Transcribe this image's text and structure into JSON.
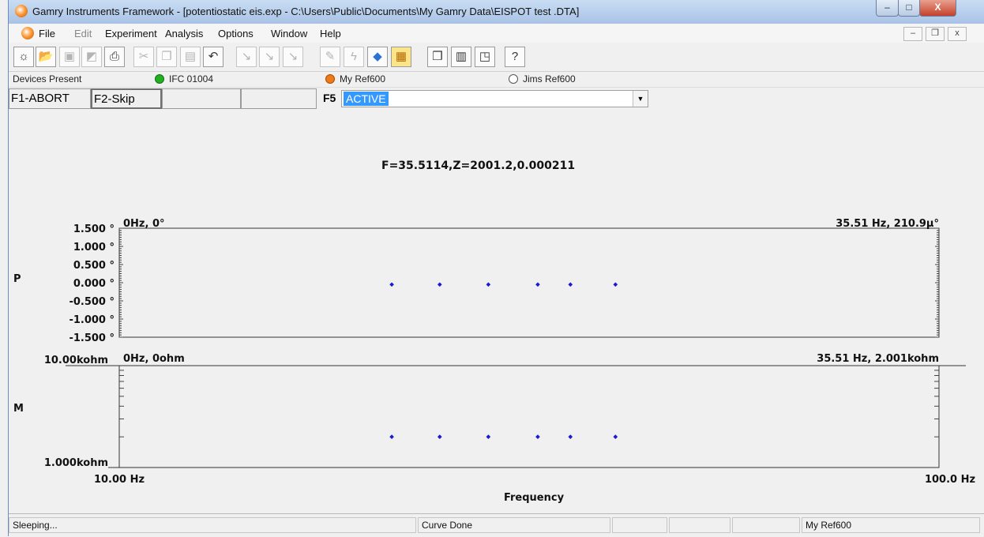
{
  "window": {
    "title": "Gamry Instruments Framework - [potentiostatic eis.exp - C:\\Users\\Public\\Documents\\My Gamry Data\\EISPOT test .DTA]",
    "minimize": "–",
    "maximize": "□",
    "close": "X"
  },
  "menu": {
    "items": [
      "File",
      "Edit",
      "Experiment",
      "Analysis",
      "Options",
      "Window",
      "Help"
    ],
    "mdi": [
      "–",
      "❐",
      "x"
    ]
  },
  "toolbar": {
    "icons": [
      "new-experiment-icon",
      "open-icon",
      "save-icon",
      "save-all-icon",
      "print-icon",
      "cut-icon",
      "copy-icon",
      "paste-icon",
      "undo-icon",
      "cell-on-icon",
      "cell-off-icon",
      "cell-toggle-icon",
      "edit-icon",
      "lightning-icon",
      "run-icon",
      "plot-icon",
      "cascade-icon",
      "tile-icon",
      "arrange-icon",
      "help-icon"
    ]
  },
  "devices": {
    "label": "Devices Present",
    "list": [
      {
        "name": "IFC 01004",
        "color": "#22b022"
      },
      {
        "name": "My Ref600",
        "color": "#f07a1a"
      },
      {
        "name": "Jims Ref600",
        "color": "#ffffff"
      }
    ]
  },
  "fkeys": {
    "f1": "F1-ABORT",
    "f2": "F2-Skip",
    "f5": "F5",
    "status": "ACTIVE"
  },
  "readout": "F=35.5114,Z=2001.2,0.000211",
  "chart_data": [
    {
      "type": "scatter",
      "ylabel": "P",
      "yticks": [
        "1.500 °",
        "1.000 °",
        "0.500 °",
        "0.000 °",
        "-0.500 °",
        "-1.000 °",
        "-1.500 °"
      ],
      "ytick_values": [
        1.5,
        1.0,
        0.5,
        0.0,
        -0.5,
        -1.0,
        -1.5
      ],
      "ylim": [
        -1.5,
        1.5
      ],
      "xlim": [
        10,
        100
      ],
      "xscale": "log",
      "corner_left": "0Hz, 0°",
      "corner_right": "35.51 Hz, 210.9µ°",
      "color": "#1a1ad0",
      "points": [
        {
          "x": 21.5,
          "y": -0.05
        },
        {
          "x": 24.6,
          "y": -0.05
        },
        {
          "x": 28.2,
          "y": -0.05
        },
        {
          "x": 32.4,
          "y": -0.05
        },
        {
          "x": 35.51,
          "y": -0.05
        },
        {
          "x": 40.3,
          "y": -0.05
        }
      ]
    },
    {
      "type": "scatter",
      "ylabel": "M",
      "yticks": [
        "10.00kohm",
        "1.000kohm"
      ],
      "ylim": [
        1000,
        10000
      ],
      "yscale": "log",
      "xlim": [
        10,
        100
      ],
      "xscale": "log",
      "xticks": [
        "10.00 Hz",
        "100.0 Hz"
      ],
      "xlabel": "Frequency",
      "corner_left": "0Hz, 0ohm",
      "corner_right": "35.51 Hz, 2.001kohm",
      "color": "#1a1ad0",
      "points": [
        {
          "x": 21.5,
          "y": 2001
        },
        {
          "x": 24.6,
          "y": 2001
        },
        {
          "x": 28.2,
          "y": 2001
        },
        {
          "x": 32.4,
          "y": 2001
        },
        {
          "x": 35.51,
          "y": 2001
        },
        {
          "x": 40.3,
          "y": 2001
        }
      ]
    }
  ],
  "statusbar": {
    "left": "Sleeping...",
    "middle": "Curve Done",
    "right": "My Ref600"
  }
}
